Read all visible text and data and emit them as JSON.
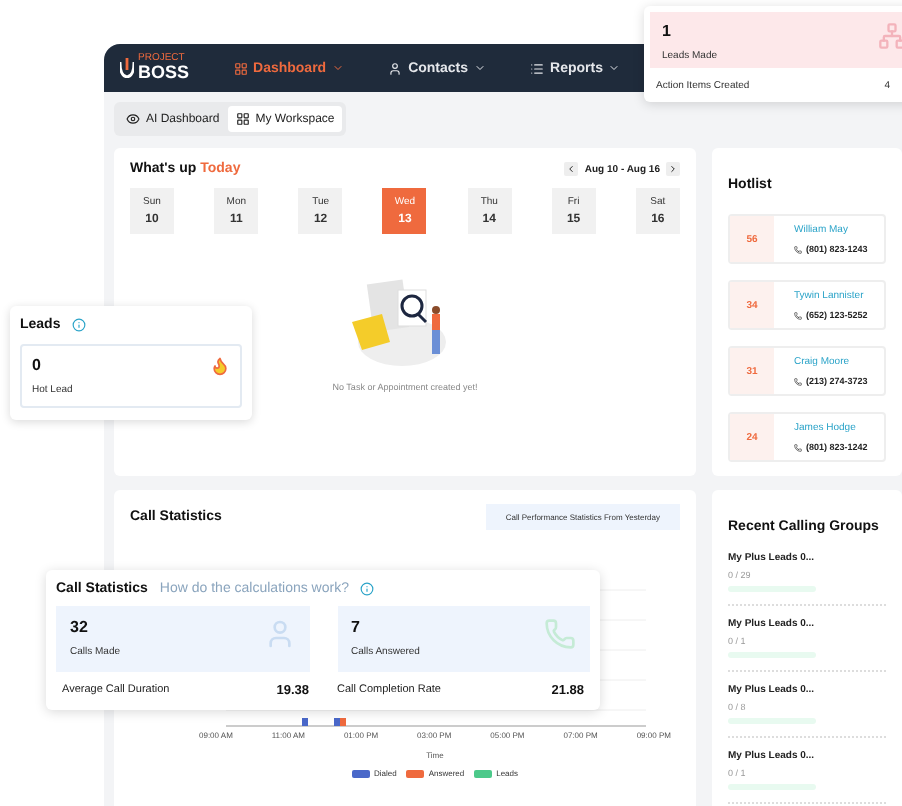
{
  "logo": {
    "top": "PROJECT",
    "name": "BOSS"
  },
  "nav": [
    {
      "label": "Dashboard",
      "selected": true
    },
    {
      "label": "Contacts",
      "selected": false
    },
    {
      "label": "Reports",
      "selected": false
    }
  ],
  "view_tabs": [
    {
      "label": "AI Dashboard",
      "selected": false
    },
    {
      "label": "My Workspace",
      "selected": true
    }
  ],
  "whats_up": {
    "title": "What's up",
    "highlight": "Today",
    "range": "Aug 10 - Aug 16",
    "days": [
      {
        "day": "Sun",
        "date": "10",
        "selected": false
      },
      {
        "day": "Mon",
        "date": "11",
        "selected": false
      },
      {
        "day": "Tue",
        "date": "12",
        "selected": false
      },
      {
        "day": "Wed",
        "date": "13",
        "selected": true
      },
      {
        "day": "Thu",
        "date": "14",
        "selected": false
      },
      {
        "day": "Fri",
        "date": "15",
        "selected": false
      },
      {
        "day": "Sat",
        "date": "16",
        "selected": false
      }
    ],
    "empty_text": "No Task or Appointment created yet!"
  },
  "hotlist": {
    "title": "Hotlist",
    "items": [
      {
        "score": "56",
        "name": "William May",
        "phone": "(801) 823-1243"
      },
      {
        "score": "34",
        "name": "Tywin Lannister",
        "phone": "(652) 123-5252"
      },
      {
        "score": "31",
        "name": "Craig Moore",
        "phone": "(213) 274-3723"
      },
      {
        "score": "24",
        "name": "James Hodge",
        "phone": "(801) 823-1242"
      }
    ]
  },
  "call_statistics": {
    "title": "Call Statistics",
    "badge": "Call Performance Statistics From Yesterday",
    "x_labels": [
      "09:00 AM",
      "11:00 AM",
      "01:00 PM",
      "03:00 PM",
      "05:00 PM",
      "07:00 PM",
      "09:00 PM"
    ],
    "x_title": "Time",
    "legend": [
      {
        "label": "Dialed",
        "color": "#4a68c9"
      },
      {
        "label": "Answered",
        "color": "#ef6a3e"
      },
      {
        "label": "Leads",
        "color": "#4cc98a"
      }
    ]
  },
  "recent_groups": {
    "title": "Recent Calling Groups",
    "items": [
      {
        "name": "My Plus Leads 0...",
        "count": "0 / 29",
        "level": 0
      },
      {
        "name": "My Plus Leads 0...",
        "count": "0 / 1",
        "level": 0
      },
      {
        "name": "My Plus Leads 0...",
        "count": "0 / 8",
        "level": 0
      },
      {
        "name": "My Plus Leads 0...",
        "count": "0 / 1",
        "level": 0
      }
    ]
  },
  "leads_popup": {
    "value": "1",
    "label": "Leads Made",
    "footer_label": "Action Items Created",
    "footer_value": "4"
  },
  "leads_card": {
    "title": "Leads",
    "value": "0",
    "label": "Hot Lead"
  },
  "stats_card": {
    "title": "Call Statistics",
    "link": "How do the calculations work?",
    "tiles": [
      {
        "value": "32",
        "label": "Calls Made"
      },
      {
        "value": "7",
        "label": "Calls Answered"
      }
    ],
    "metrics": [
      {
        "label": "Average Call Duration",
        "value": "19.38"
      },
      {
        "label": "Call Completion Rate",
        "value": "21.88"
      }
    ]
  }
}
